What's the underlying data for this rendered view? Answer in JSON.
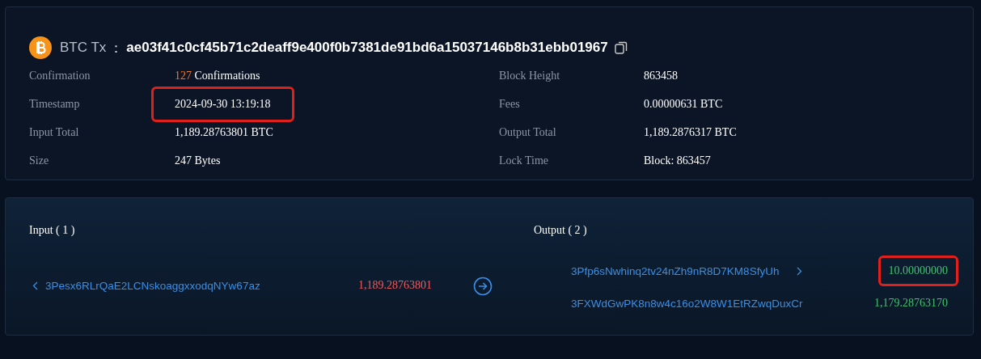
{
  "header": {
    "prefix": "BTC Tx",
    "separator": "：",
    "hash": "ae03f41c0cf45b71c2deaff9e400f0b7381de91bd6a15037146b8b31ebb01967"
  },
  "details": [
    {
      "label": "Confirmation",
      "count": "127",
      "value": "Confirmations",
      "highlighted": false
    },
    {
      "label": "Block Height",
      "value": "863458",
      "highlighted": false
    },
    {
      "label": "Timestamp",
      "value": "2024-09-30 13:19:18",
      "highlighted": true
    },
    {
      "label": "Fees",
      "value": "0.00000631 BTC",
      "highlighted": false
    },
    {
      "label": "Input Total",
      "value": "1,189.28763801 BTC",
      "highlighted": false
    },
    {
      "label": "Output Total",
      "value": "1,189.2876317 BTC",
      "highlighted": false
    },
    {
      "label": "Size",
      "value": "247 Bytes",
      "highlighted": false
    },
    {
      "label": "Lock Time",
      "value": "Block: 863457",
      "highlighted": false
    }
  ],
  "input": {
    "title": "Input ( 1 )",
    "items": [
      {
        "address": "3Pesx6RLrQaE2LCNskoaggxxodqNYw67az",
        "amount": "1,189.28763801",
        "chevron": true,
        "highlighted": false
      }
    ]
  },
  "output": {
    "title": "Output ( 2 )",
    "items": [
      {
        "address": "3Pfp6sNwhinq2tv24nZh9nR8D7KM8SfyUh",
        "amount": "10.00000000",
        "chevron": true,
        "highlighted": true
      },
      {
        "address": "3FXWdGwPK8n8w4c16o2W8W1EtRZwqDuxCr",
        "amount": "1,179.28763170",
        "chevron": false,
        "highlighted": false
      }
    ]
  }
}
